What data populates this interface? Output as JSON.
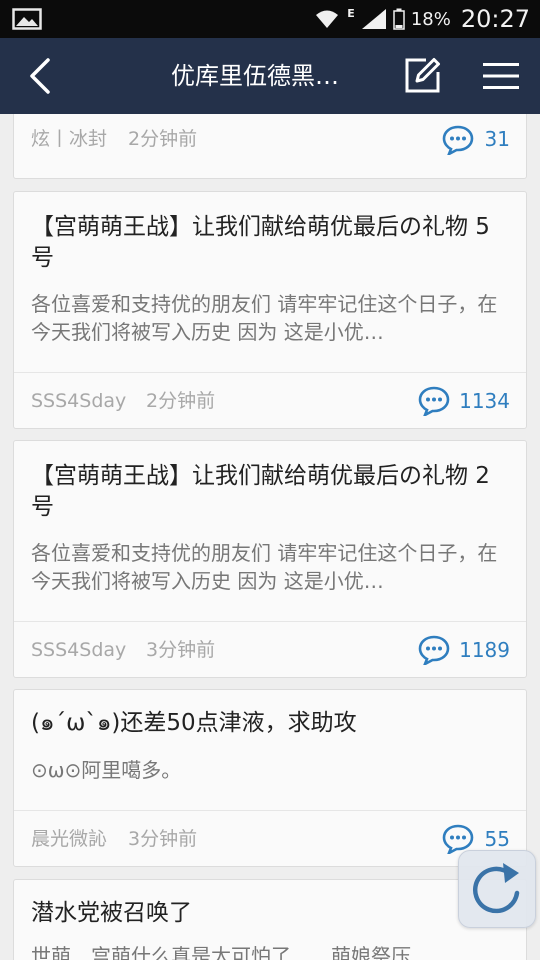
{
  "status_bar": {
    "network": "E",
    "battery": "18%",
    "time": "20:27"
  },
  "nav": {
    "title": "优库里伍德黑…"
  },
  "colors": {
    "nav_bg": "#24314a",
    "accent": "#2f7ebf",
    "card_bg": "#fafafa",
    "page_bg": "#eeeeee"
  },
  "icons": {
    "back": "chevron-left-icon",
    "edit": "edit-icon",
    "menu": "hamburger-menu-icon",
    "comment": "comment-bubble-icon",
    "refresh": "refresh-icon"
  },
  "posts": [
    {
      "title": "",
      "excerpt": "",
      "author": "炫丨冰封",
      "time": "2分钟前",
      "comments": "31"
    },
    {
      "title": "【宫萌萌王战】让我们献给萌优最后の礼物 5号",
      "excerpt": "各位喜爱和支持优的朋友们 请牢牢记住这个日子，在今天我们将被写入历史 因为 这是小优…",
      "author": "SSS4Sday",
      "time": "2分钟前",
      "comments": "1134"
    },
    {
      "title": "【宫萌萌王战】让我们献给萌优最后の礼物 2号",
      "excerpt": "各位喜爱和支持优的朋友们 请牢牢记住这个日子，在今天我们将被写入历史 因为 这是小优…",
      "author": "SSS4Sday",
      "time": "3分钟前",
      "comments": "1189"
    },
    {
      "title": "(๑´ω`๑)还差50点津液，求助攻",
      "excerpt": "⊙ω⊙阿里噶多。",
      "author": "晨光微訫",
      "time": "3分钟前",
      "comments": "55"
    },
    {
      "title": "潜水党被召唤了",
      "excerpt": "世萌…宫萌什么真是太可怕了……萌娘祭压",
      "author": "",
      "time": "",
      "comments": ""
    }
  ]
}
